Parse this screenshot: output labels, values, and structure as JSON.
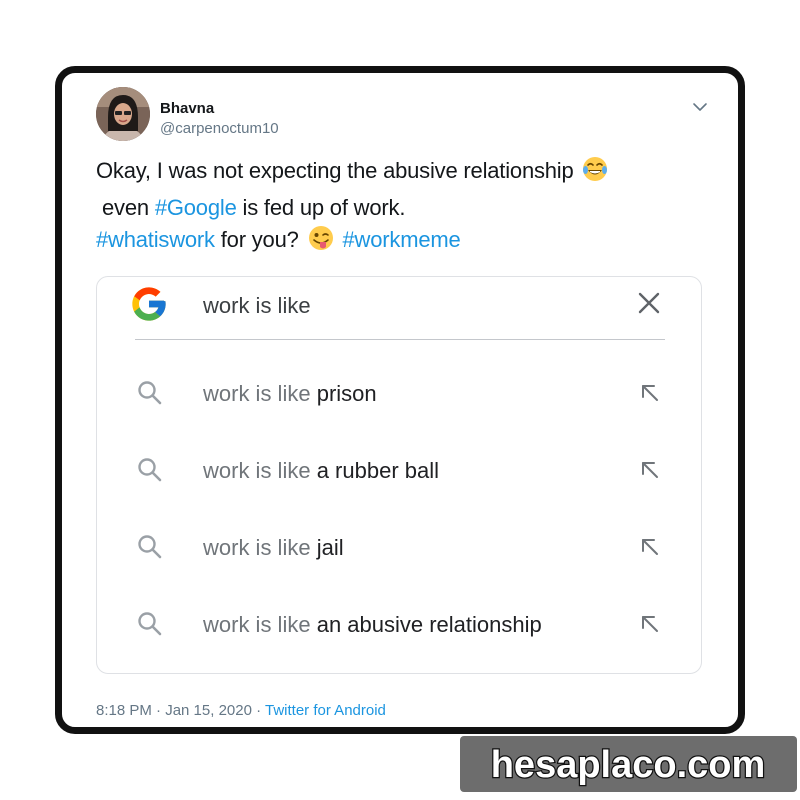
{
  "tweet": {
    "display_name": "Bhavna",
    "handle": "@carpenoctum10",
    "text_line1": "Okay, I was not expecting the abusive relationship",
    "text_line2_pre": "even",
    "hashtag_google": "#Google",
    "text_line2_post": "is fed up of work.",
    "hashtag_whatiswork": "#whatiswork",
    "text_line3_mid": "for you?",
    "hashtag_workmeme": "#workmeme",
    "timestamp": "8:18 PM · Jan 15, 2020",
    "separator": " · ",
    "source": "Twitter for Android",
    "icons": {
      "menu": "chevron-down-icon",
      "emoji_1": "face-with-tears-of-joy-emoji",
      "emoji_2": "winking-face-with-tongue-emoji"
    }
  },
  "search": {
    "query": "work is like",
    "logo": "google-g-logo",
    "clear_icon": "close-icon",
    "suggestions": [
      {
        "prefix": "work is like",
        "suffix": "prison",
        "icon": "search-icon",
        "action_icon": "arrow-up-left-icon"
      },
      {
        "prefix": "work is like",
        "suffix": "a rubber ball",
        "icon": "search-icon",
        "action_icon": "arrow-up-left-icon"
      },
      {
        "prefix": "work is like",
        "suffix": "jail",
        "icon": "search-icon",
        "action_icon": "arrow-up-left-icon"
      },
      {
        "prefix": "work is like",
        "suffix": "an abusive relationship",
        "icon": "search-icon",
        "action_icon": "arrow-up-left-icon"
      }
    ]
  },
  "watermark": {
    "text": "hesaplaco.com"
  },
  "colors": {
    "hashtag": "#1b95e0",
    "text": "#14171a",
    "muted": "#657786",
    "google_blue": "#4285F4",
    "google_red": "#EA4335",
    "google_yellow": "#FBBC05",
    "google_green": "#34A853"
  }
}
